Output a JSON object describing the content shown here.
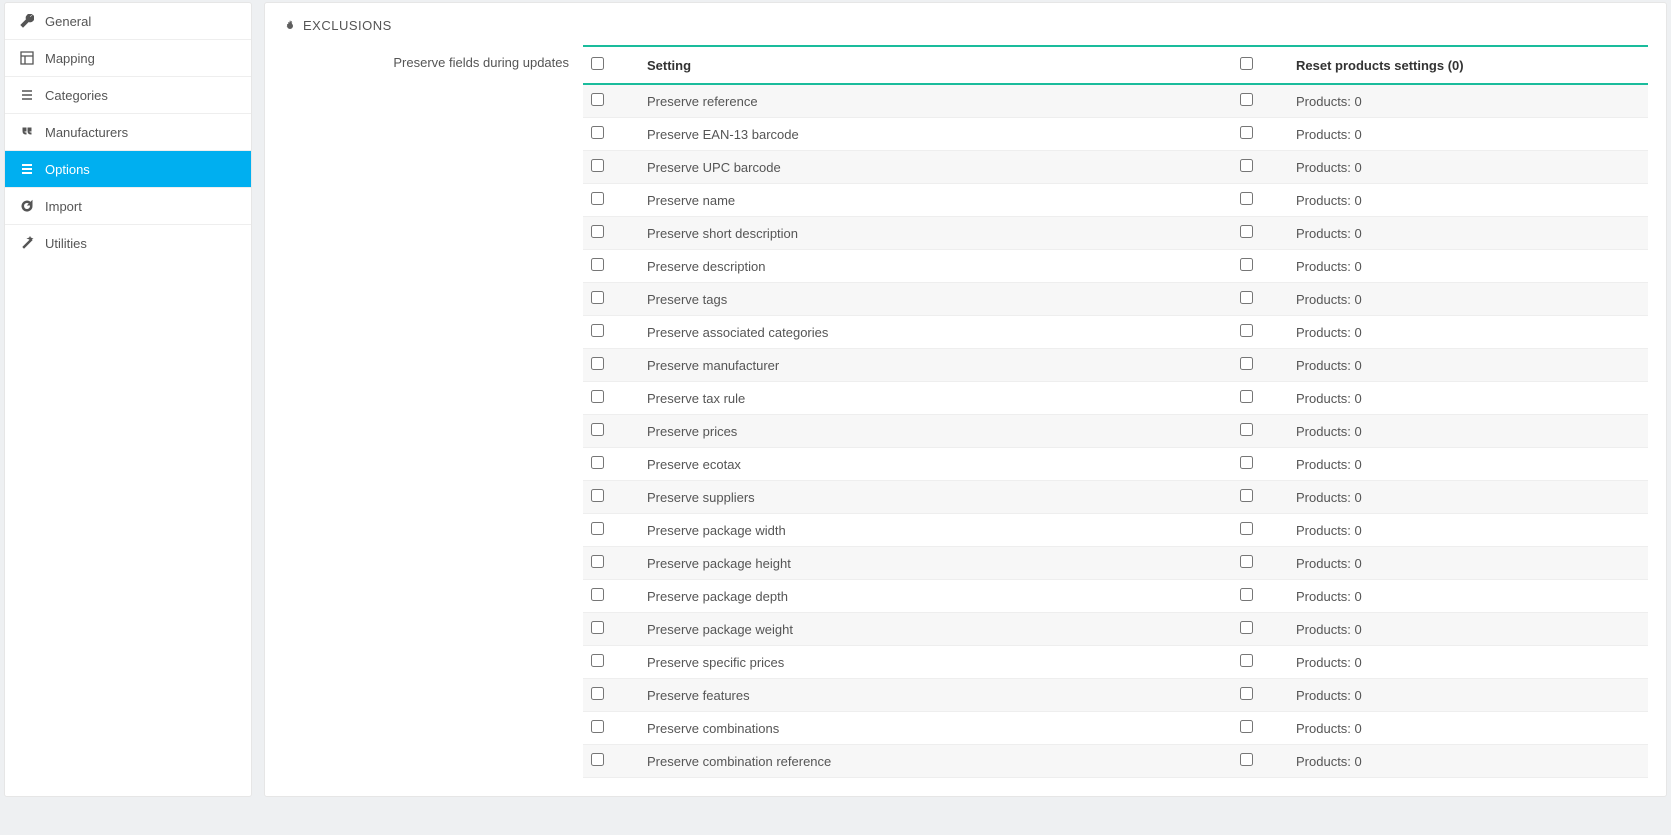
{
  "sidebar": {
    "items": [
      {
        "label": "General",
        "icon": "wrench-icon",
        "active": false
      },
      {
        "label": "Mapping",
        "icon": "layout-icon",
        "active": false
      },
      {
        "label": "Categories",
        "icon": "list-icon",
        "active": false
      },
      {
        "label": "Manufacturers",
        "icon": "quote-icon",
        "active": false
      },
      {
        "label": "Options",
        "icon": "bars-icon",
        "active": true
      },
      {
        "label": "Import",
        "icon": "refresh-icon",
        "active": false
      },
      {
        "label": "Utilities",
        "icon": "wand-icon",
        "active": false
      }
    ]
  },
  "panel": {
    "title": "EXCLUSIONS",
    "field_label": "Preserve fields during updates",
    "table": {
      "headers": {
        "setting": "Setting",
        "reset": "Reset products settings (0)"
      },
      "rows": [
        {
          "setting": "Preserve reference",
          "reset": "Products: 0"
        },
        {
          "setting": "Preserve EAN-13 barcode",
          "reset": "Products: 0"
        },
        {
          "setting": "Preserve UPC barcode",
          "reset": "Products: 0"
        },
        {
          "setting": "Preserve name",
          "reset": "Products: 0"
        },
        {
          "setting": "Preserve short description",
          "reset": "Products: 0"
        },
        {
          "setting": "Preserve description",
          "reset": "Products: 0"
        },
        {
          "setting": "Preserve tags",
          "reset": "Products: 0"
        },
        {
          "setting": "Preserve associated categories",
          "reset": "Products: 0"
        },
        {
          "setting": "Preserve manufacturer",
          "reset": "Products: 0"
        },
        {
          "setting": "Preserve tax rule",
          "reset": "Products: 0"
        },
        {
          "setting": "Preserve prices",
          "reset": "Products: 0"
        },
        {
          "setting": "Preserve ecotax",
          "reset": "Products: 0"
        },
        {
          "setting": "Preserve suppliers",
          "reset": "Products: 0"
        },
        {
          "setting": "Preserve package width",
          "reset": "Products: 0"
        },
        {
          "setting": "Preserve package height",
          "reset": "Products: 0"
        },
        {
          "setting": "Preserve package depth",
          "reset": "Products: 0"
        },
        {
          "setting": "Preserve package weight",
          "reset": "Products: 0"
        },
        {
          "setting": "Preserve specific prices",
          "reset": "Products: 0"
        },
        {
          "setting": "Preserve features",
          "reset": "Products: 0"
        },
        {
          "setting": "Preserve combinations",
          "reset": "Products: 0"
        },
        {
          "setting": "Preserve combination reference",
          "reset": "Products: 0"
        }
      ]
    }
  }
}
